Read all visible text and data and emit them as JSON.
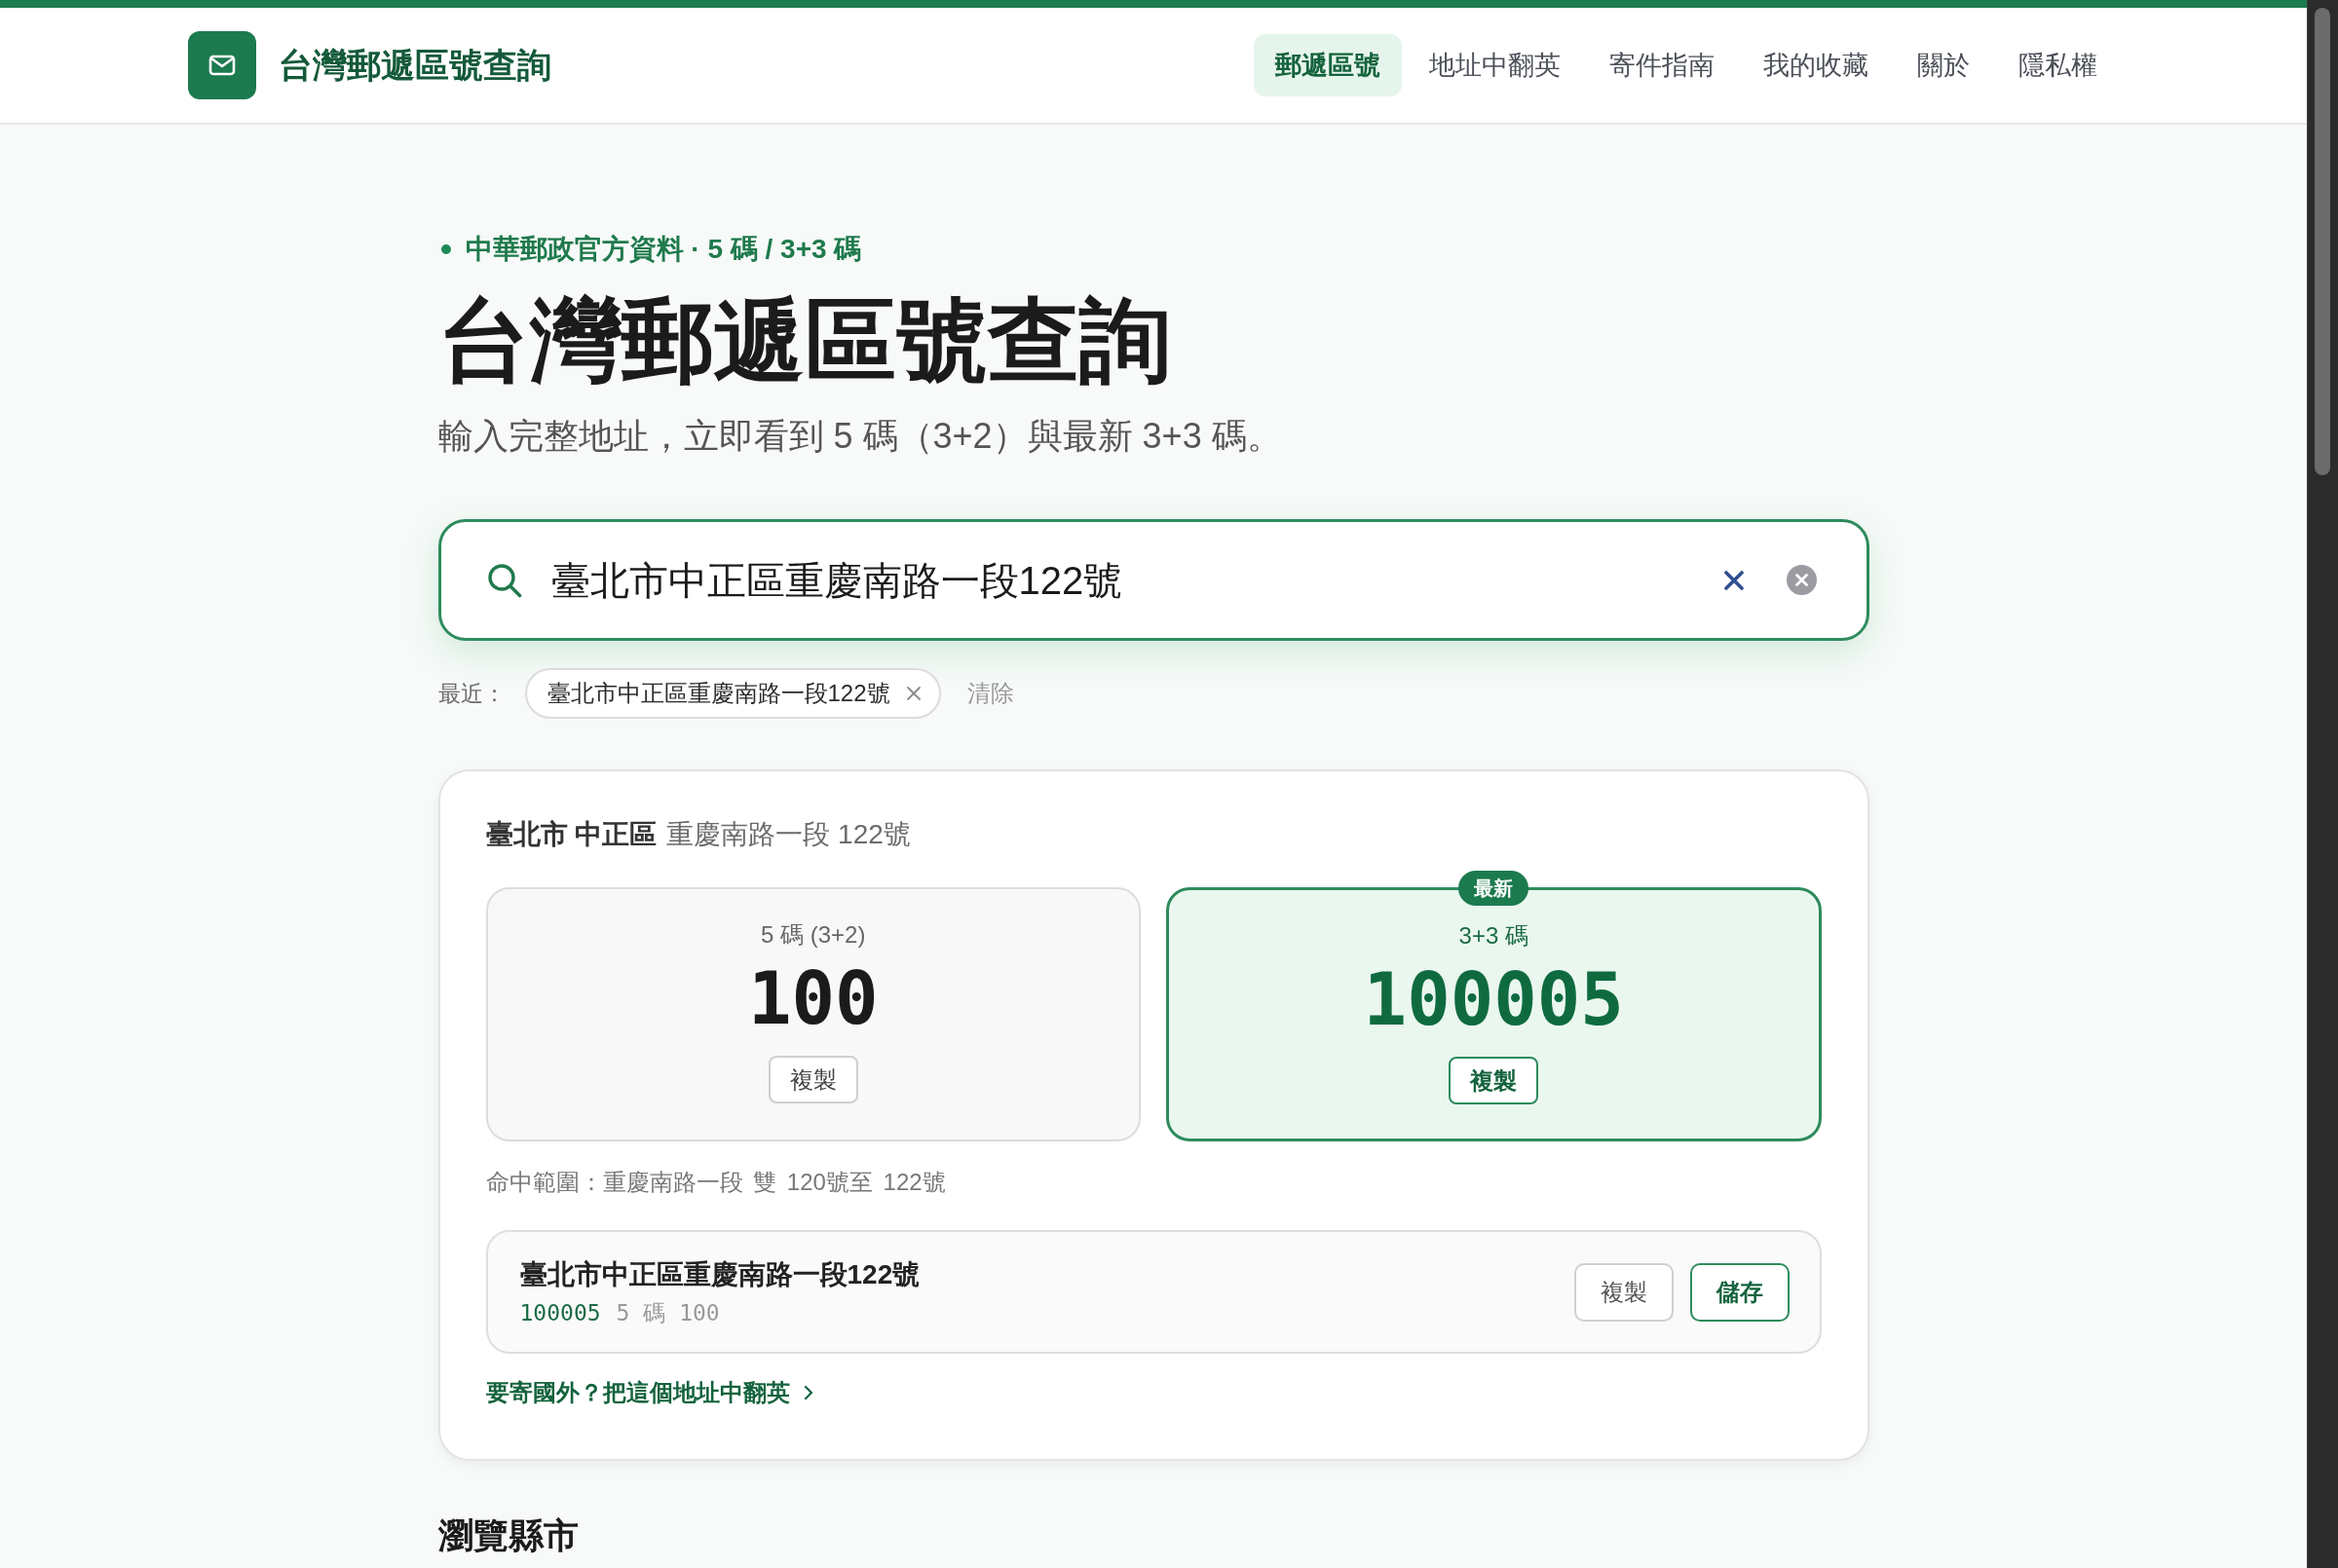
{
  "header": {
    "brand": "台灣郵遞區號查詢",
    "nav": [
      {
        "label": "郵遞區號",
        "selected": true
      },
      {
        "label": "地址中翻英",
        "selected": false
      },
      {
        "label": "寄件指南",
        "selected": false
      },
      {
        "label": "我的收藏",
        "selected": false
      },
      {
        "label": "關於",
        "selected": false
      },
      {
        "label": "隱私權",
        "selected": false
      }
    ]
  },
  "hero": {
    "eyebrow": "中華郵政官方資料 · 5 碼 / 3+3 碼",
    "title": "台灣郵遞區號查詢",
    "subtitle": "輸入完整地址，立即看到 5 碼（3+2）與最新 3+3 碼。"
  },
  "search": {
    "value": "臺北市中正區重慶南路一段122號"
  },
  "recent": {
    "label": "最近：",
    "items": [
      "臺北市中正區重慶南路一段122號"
    ],
    "clear": "清除"
  },
  "result": {
    "place": "臺北市 中正區",
    "street": "重慶南路一段 122號",
    "codes": [
      {
        "label": "5 碼 (3+2)",
        "code": "100",
        "button": "複製",
        "highlighted": false
      },
      {
        "label": "3+3 碼",
        "code": "100005",
        "badge": "最新",
        "button": "複製",
        "highlighted": true
      }
    ],
    "range": "命中範圍：重慶南路一段 雙 120號至 122號",
    "entry": {
      "address": "臺北市中正區重慶南路一段122號",
      "code": "100005",
      "detail": "5 碼 100",
      "buttons": [
        {
          "label": "複製",
          "kind": "secondary"
        },
        {
          "label": "儲存",
          "kind": "primary"
        }
      ]
    },
    "link": "要寄國外？把這個地址中翻英"
  },
  "browse": {
    "title": "瀏覽縣市"
  }
}
